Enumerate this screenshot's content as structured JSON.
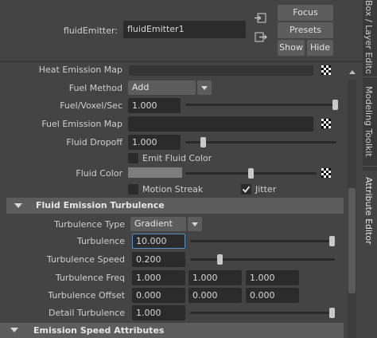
{
  "header": {
    "node_label": "fluidEmitter:",
    "node_value": "fluidEmitter1",
    "focus_label": "Focus",
    "presets_label": "Presets",
    "show_label": "Show",
    "hide_label": "Hide"
  },
  "side_tabs": {
    "channel_box": "Box / Layer Editor",
    "modeling_toolkit": "Modeling Toolkit",
    "attribute_editor": "Attribute Editor"
  },
  "fuel": {
    "heat_emission_map_label": "Heat Emission Map",
    "fuel_method_label": "Fuel Method",
    "fuel_method_value": "Add",
    "fuel_voxel_label": "Fuel/Voxel/Sec",
    "fuel_voxel_value": "1.000",
    "fuel_voxel_level": 1.0,
    "fuel_emission_map_label": "Fuel Emission Map",
    "fluid_dropoff_label": "Fluid Dropoff",
    "fluid_dropoff_value": "1.000",
    "fluid_dropoff_level": 0.05,
    "emit_fluid_color_label": "Emit Fluid Color",
    "emit_fluid_color_checked": false,
    "fluid_color_label": "Fluid Color",
    "fluid_color_hex": "#7d7d7d",
    "fluid_color_level": 0.5,
    "motion_streak_label": "Motion Streak",
    "motion_streak_checked": false,
    "jitter_label": "Jitter",
    "jitter_checked": true
  },
  "turbulence": {
    "section_title": "Fluid Emission Turbulence",
    "type_label": "Turbulence Type",
    "type_value": "Gradient",
    "turbulence_label": "Turbulence",
    "turbulence_value": "10.000",
    "turbulence_level": 1.0,
    "speed_label": "Turbulence Speed",
    "speed_value": "0.200",
    "speed_level": 0.2,
    "freq_label": "Turbulence Freq",
    "freq_values": [
      "1.000",
      "1.000",
      "1.000"
    ],
    "offset_label": "Turbulence Offset",
    "offset_values": [
      "0.000",
      "0.000",
      "0.000"
    ],
    "detail_label": "Detail Turbulence",
    "detail_value": "1.000",
    "detail_level": 1.0
  },
  "emission_speed": {
    "section_title": "Emission Speed Attributes"
  },
  "colors": {
    "panel_bg": "#444444",
    "field_bg": "#2b2b2b",
    "button_bg": "#5d5d5d",
    "focus_border": "#5b8fc7"
  }
}
